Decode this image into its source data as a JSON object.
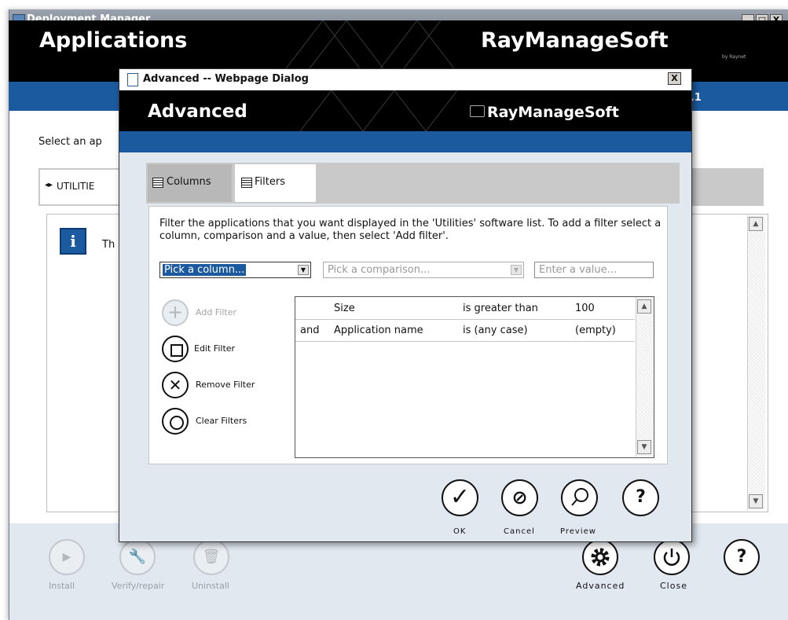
{
  "main_window": {
    "title": "Deployment Manager",
    "controls": [
      "_",
      "□",
      "X"
    ],
    "page_title": "Applications",
    "brand": "RayManageSoft",
    "brand_sub": "by Raynet",
    "version": "n 10.1",
    "select_text": "Select an ap",
    "tab_label": "UTILITIE",
    "info_text": "Th",
    "footer": {
      "install": "Install",
      "verify": "Verify/repair",
      "uninstall": "Uninstall",
      "advanced": "Advanced",
      "close": "Close",
      "help": "?"
    }
  },
  "dialog": {
    "title": "Advanced -- Webpage Dialog",
    "heading": "Advanced",
    "brand": "RayManageSoft",
    "tabs": [
      {
        "label": "Columns",
        "selected": false
      },
      {
        "label": "Filters",
        "selected": true
      }
    ],
    "description": "Filter the applications that you want displayed in the 'Utilities' software list. To add a filter select a column, comparison and a value, then select 'Add filter'.",
    "column_select": "Pick a column...",
    "comparison_select": "Pick a comparison...",
    "value_placeholder": "Enter a value...",
    "actions": {
      "add": "Add Filter",
      "edit": "Edit Filter",
      "remove": "Remove Filter",
      "clear": "Clear Filters"
    },
    "filters": [
      {
        "join": "",
        "column": "Size",
        "comparison": "is greater than",
        "value": "100"
      },
      {
        "join": "and",
        "column": "Application name",
        "comparison": "is (any case)",
        "value": "(empty)"
      }
    ],
    "buttons": {
      "ok": "OK",
      "cancel": "Cancel",
      "preview": "Preview",
      "help": "?"
    }
  },
  "colors": {
    "accent_blue": "#1c5aa0",
    "banner_black": "#000000",
    "footer_bg": "#e1e8f0"
  }
}
